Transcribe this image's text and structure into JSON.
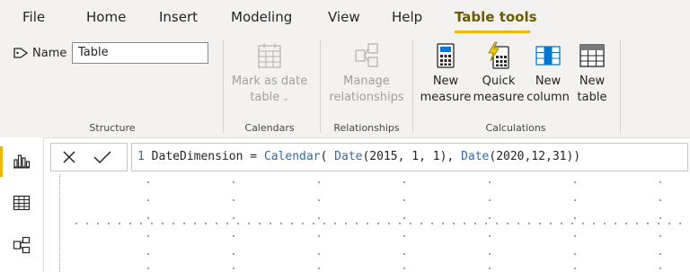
{
  "tabs": [
    "File",
    "Home",
    "Insert",
    "Modeling",
    "View",
    "Help",
    "Table tools"
  ],
  "structure": {
    "name_label": "Name",
    "name_value": "Table",
    "group_label": "Structure"
  },
  "calendars": {
    "mark_line1": "Mark as date",
    "mark_line2": "table",
    "group_label": "Calendars"
  },
  "relationships": {
    "manage_line1": "Manage",
    "manage_line2": "relationships",
    "group_label": "Relationships"
  },
  "calculations": {
    "new_measure_1": "New",
    "new_measure_2": "measure",
    "quick_measure_1": "Quick",
    "quick_measure_2": "measure",
    "new_column_1": "New",
    "new_column_2": "column",
    "new_table_1": "New",
    "new_table_2": "table",
    "group_label": "Calculations"
  },
  "formula": {
    "line_number": "1",
    "name": "DateDimension = ",
    "fn_calendar": "Calendar",
    "open": "( ",
    "fn_date1": "Date",
    "args1": "(2015, 1, 1), ",
    "fn_date2": "Date",
    "args2": "(2020,12,31))"
  },
  "colors": {
    "accent": "#e8b90a",
    "keyword": "#2b6cb0"
  },
  "icons": {
    "name": "tag-icon",
    "cancel": "close-icon",
    "commit": "check-icon",
    "rail": [
      "report-view-icon",
      "data-view-icon",
      "model-view-icon"
    ]
  }
}
